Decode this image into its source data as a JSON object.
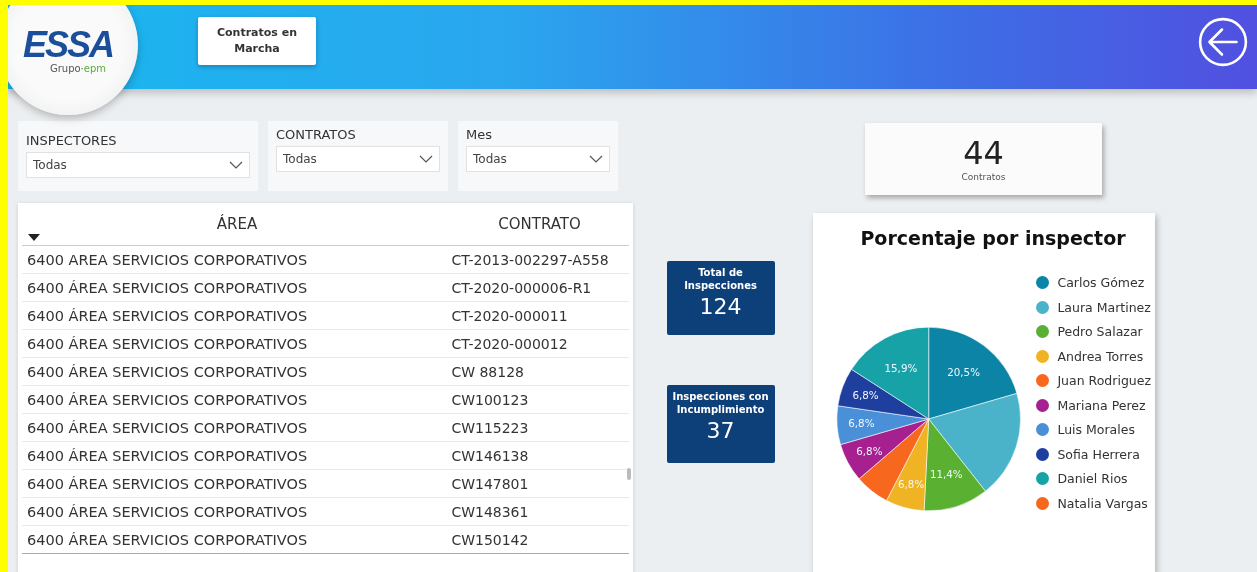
{
  "header": {
    "logo": {
      "brand": "ESSA",
      "group": "Grupo·",
      "group_accent": "epm"
    },
    "nav_button": "Contratos en Marcha"
  },
  "filters": [
    {
      "label": "INSPECTORES",
      "value": "Todas"
    },
    {
      "label": "CONTRATOS",
      "value": "Todas"
    },
    {
      "label": "Mes",
      "value": "Todas"
    }
  ],
  "table": {
    "columns": [
      {
        "label": "ÁREA",
        "sorted": true
      },
      {
        "label": "CONTRATO",
        "sorted": false
      }
    ],
    "rows": [
      [
        "6400 AREA SERVICIOS CORPORATIVOS",
        "CT-2013-002297-A558"
      ],
      [
        "6400 ÁREA SERVICIOS CORPORATIVOS",
        "CT-2020-000006-R1"
      ],
      [
        "6400 ÁREA SERVICIOS CORPORATIVOS",
        "CT-2020-000011"
      ],
      [
        "6400 ÁREA SERVICIOS CORPORATIVOS",
        "CT-2020-000012"
      ],
      [
        "6400 ÁREA SERVICIOS CORPORATIVOS",
        "CW 88128"
      ],
      [
        "6400 ÁREA SERVICIOS CORPORATIVOS",
        "CW100123"
      ],
      [
        "6400 ÁREA SERVICIOS CORPORATIVOS",
        "CW115223"
      ],
      [
        "6400 ÁREA SERVICIOS CORPORATIVOS",
        "CW146138"
      ],
      [
        "6400 ÁREA SERVICIOS CORPORATIVOS",
        "CW147801"
      ],
      [
        "6400 ÁREA SERVICIOS CORPORATIVOS",
        "CW148361"
      ],
      [
        "6400 ÁREA SERVICIOS CORPORATIVOS",
        "CW150142"
      ]
    ]
  },
  "kpis": [
    {
      "label": "Total de Inspecciones",
      "value": "124"
    },
    {
      "label": "Inspecciones con Incumplimiento",
      "value": "37"
    }
  ],
  "contracts_card": {
    "value": "44",
    "label": "Contratos"
  },
  "pie": {
    "chart_data": {
      "type": "pie",
      "title": "Porcentaje por inspector",
      "categories": [
        "Carlos Gómez",
        "Laura Martinez",
        "Pedro Salazar",
        "Andrea Torres",
        "Juan Rodriguez",
        "Mariana Perez",
        "Luis Morales",
        "Sofia Herrera",
        "Daniel Rios",
        "Natalia Vargas"
      ],
      "legend": "right",
      "series": [
        {
          "colors": [
            "#0b84a5",
            "#4ab3c9",
            "#5ab031",
            "#f0b323",
            "#f7681e",
            "#a6218f",
            "#4a90d9",
            "#1f3f9f",
            "#17a2a8",
            "#f7681e"
          ],
          "values": [
            20.5,
            18.9,
            11.4,
            6.8,
            6.1,
            6.8,
            6.8,
            6.8,
            15.9,
            null
          ]
        }
      ],
      "value_labels": [
        "20,5%",
        null,
        "11,4%",
        "6,8%",
        null,
        "6,8%",
        "6,8%",
        "6,8%",
        "15,9%",
        null
      ]
    }
  }
}
